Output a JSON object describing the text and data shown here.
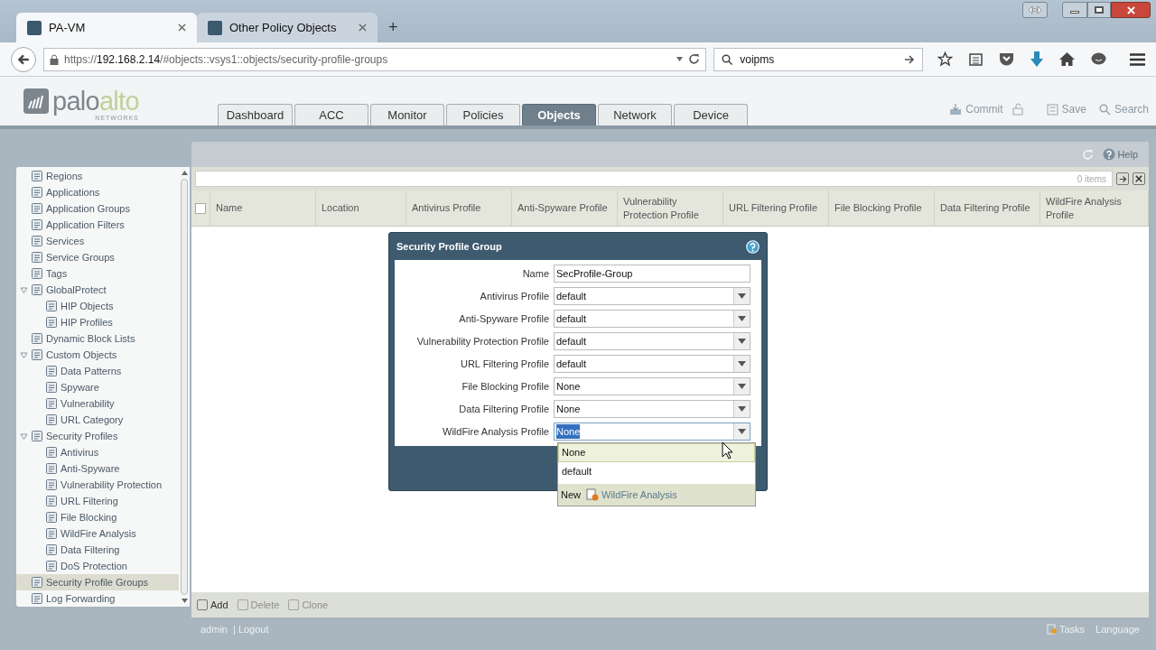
{
  "browser": {
    "tabs": [
      {
        "label": "PA-VM",
        "selected": true
      },
      {
        "label": "Other Policy Objects",
        "selected": false
      }
    ],
    "new_tab": "+",
    "url_host": "192.168.2.14",
    "url_prefix": "https://",
    "url_path": "/#objects::vsys1::objects/security-profile-groups",
    "search_value": "voipms"
  },
  "app": {
    "logo_main": "palo",
    "logo_accent": "alto",
    "logo_sub": "NETWORKS",
    "tabs": [
      {
        "label": "Dashboard",
        "selected": false
      },
      {
        "label": "ACC",
        "selected": false
      },
      {
        "label": "Monitor",
        "selected": false
      },
      {
        "label": "Policies",
        "selected": false
      },
      {
        "label": "Objects",
        "selected": true
      },
      {
        "label": "Network",
        "selected": false
      },
      {
        "label": "Device",
        "selected": false
      }
    ],
    "actions": [
      "Commit",
      "Save",
      "Search"
    ],
    "help": "Help"
  },
  "sidebar": {
    "items": [
      {
        "label": "Regions",
        "selected": false
      },
      {
        "label": "Applications",
        "selected": false
      },
      {
        "label": "Application Groups",
        "selected": false
      },
      {
        "label": "Application Filters",
        "selected": false
      },
      {
        "label": "Services",
        "selected": false
      },
      {
        "label": "Service Groups",
        "selected": false
      },
      {
        "label": "Tags",
        "selected": false
      },
      {
        "label": "GlobalProtect",
        "selected": false,
        "expanded": true,
        "children": [
          {
            "label": "HIP Objects",
            "selected": false
          },
          {
            "label": "HIP Profiles",
            "selected": false
          }
        ]
      },
      {
        "label": "Dynamic Block Lists",
        "selected": false
      },
      {
        "label": "Custom Objects",
        "selected": false,
        "expanded": true,
        "children": [
          {
            "label": "Data Patterns",
            "selected": false
          },
          {
            "label": "Spyware",
            "selected": false
          },
          {
            "label": "Vulnerability",
            "selected": false
          },
          {
            "label": "URL Category",
            "selected": false
          }
        ]
      },
      {
        "label": "Security Profiles",
        "selected": false,
        "expanded": true,
        "children": [
          {
            "label": "Antivirus",
            "selected": false
          },
          {
            "label": "Anti-Spyware",
            "selected": false
          },
          {
            "label": "Vulnerability Protection",
            "selected": false
          },
          {
            "label": "URL Filtering",
            "selected": false
          },
          {
            "label": "File Blocking",
            "selected": false
          },
          {
            "label": "WildFire Analysis",
            "selected": false
          },
          {
            "label": "Data Filtering",
            "selected": false
          },
          {
            "label": "DoS Protection",
            "selected": false
          }
        ]
      },
      {
        "label": "Security Profile Groups",
        "selected": true
      },
      {
        "label": "Log Forwarding",
        "selected": false
      }
    ]
  },
  "table": {
    "select_all_checked": false,
    "item_count": "0 items",
    "columns": [
      "Name",
      "Location",
      "Antivirus Profile",
      "Anti-Spyware Profile",
      "Vulnerability Protection Profile",
      "URL Filtering Profile",
      "File Blocking Profile",
      "Data Filtering Profile",
      "WildFire Analysis Profile"
    ]
  },
  "bottom_actions": [
    {
      "label": "Add",
      "disabled": false
    },
    {
      "label": "Delete",
      "disabled": true
    },
    {
      "label": "Clone",
      "disabled": true
    }
  ],
  "status_bar": {
    "user": "admin",
    "logout": "| Logout",
    "tasks": "Tasks",
    "language": "Language"
  },
  "dialog": {
    "title": "Security Profile Group",
    "fields": [
      {
        "kind": "text",
        "label": "Name",
        "value": "SecProfile-Group"
      },
      {
        "kind": "select",
        "label": "Antivirus Profile",
        "value": "default",
        "focused": false
      },
      {
        "kind": "select",
        "label": "Anti-Spyware Profile",
        "value": "default",
        "focused": false
      },
      {
        "kind": "select",
        "label": "Vulnerability Protection Profile",
        "value": "default",
        "focused": false
      },
      {
        "kind": "select",
        "label": "URL Filtering Profile",
        "value": "default",
        "focused": false
      },
      {
        "kind": "select",
        "label": "File Blocking Profile",
        "value": "None",
        "focused": false
      },
      {
        "kind": "select",
        "label": "Data Filtering Profile",
        "value": "None",
        "focused": false
      },
      {
        "kind": "select",
        "label": "WildFire Analysis Profile",
        "value": "None",
        "focused": true
      }
    ],
    "dropdown": {
      "options": [
        {
          "label": "None",
          "selected": true
        },
        {
          "label": "default",
          "selected": false
        }
      ],
      "new_label": "New",
      "new_link": "WildFire Analysis"
    }
  }
}
